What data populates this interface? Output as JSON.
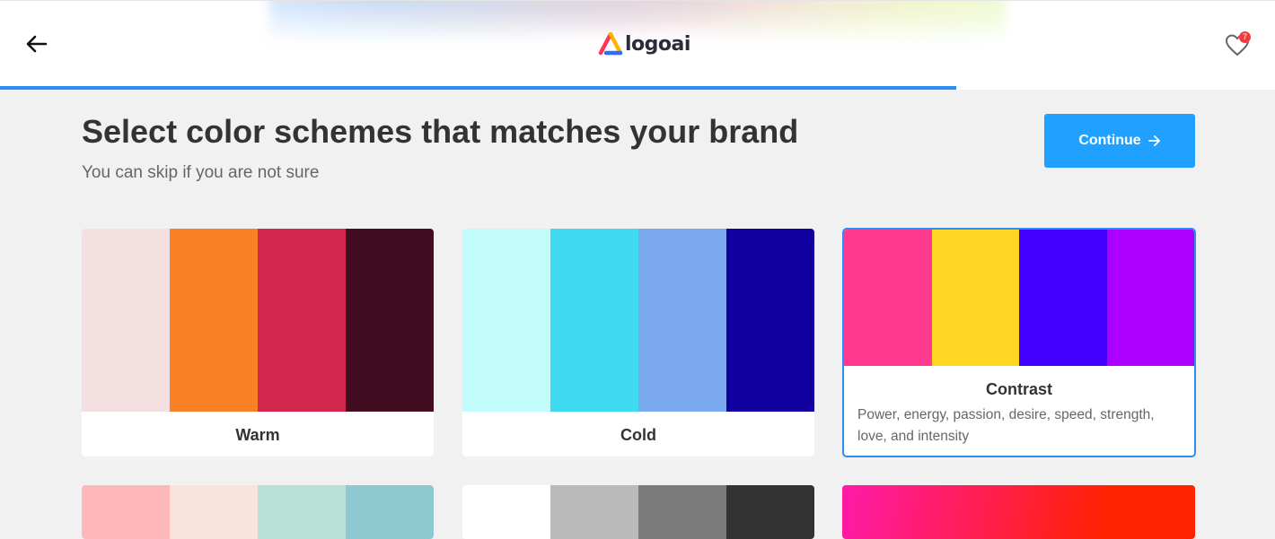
{
  "header": {
    "logo_text": "logoai",
    "favorites_count": "7",
    "progress_percent": 75
  },
  "page": {
    "title": "Select color schemes that matches your brand",
    "subtitle": "You can skip if you are not sure",
    "continue_label": "Continue"
  },
  "schemes": [
    {
      "name": "Warm",
      "colors": [
        "#f4e0e0",
        "#f88125",
        "#d2284d",
        "#410d20"
      ]
    },
    {
      "name": "Cold",
      "colors": [
        "#c1fcfb",
        "#40daf0",
        "#7aa9ef",
        "#1201a0"
      ]
    },
    {
      "name": "Contrast",
      "description": "Power, energy, passion, desire, speed, strength, love, and intensity",
      "colors": [
        "#ff3a90",
        "#ffd624",
        "#4400ff",
        "#ab00ff"
      ],
      "selected": true
    },
    {
      "colors": [
        "#feb8ba",
        "#f9e4dc",
        "#bae0d8",
        "#8ec9d1"
      ]
    },
    {
      "colors": [
        "#ffffff",
        "#bababa",
        "#7a7a7a",
        "#333333"
      ]
    },
    {
      "colors": [
        "#ff1aa8",
        "#ff2200"
      ]
    }
  ],
  "colors": {
    "accent": "#21a1ff",
    "progress": "#2a8ff0",
    "badge": "#f33b3b"
  }
}
